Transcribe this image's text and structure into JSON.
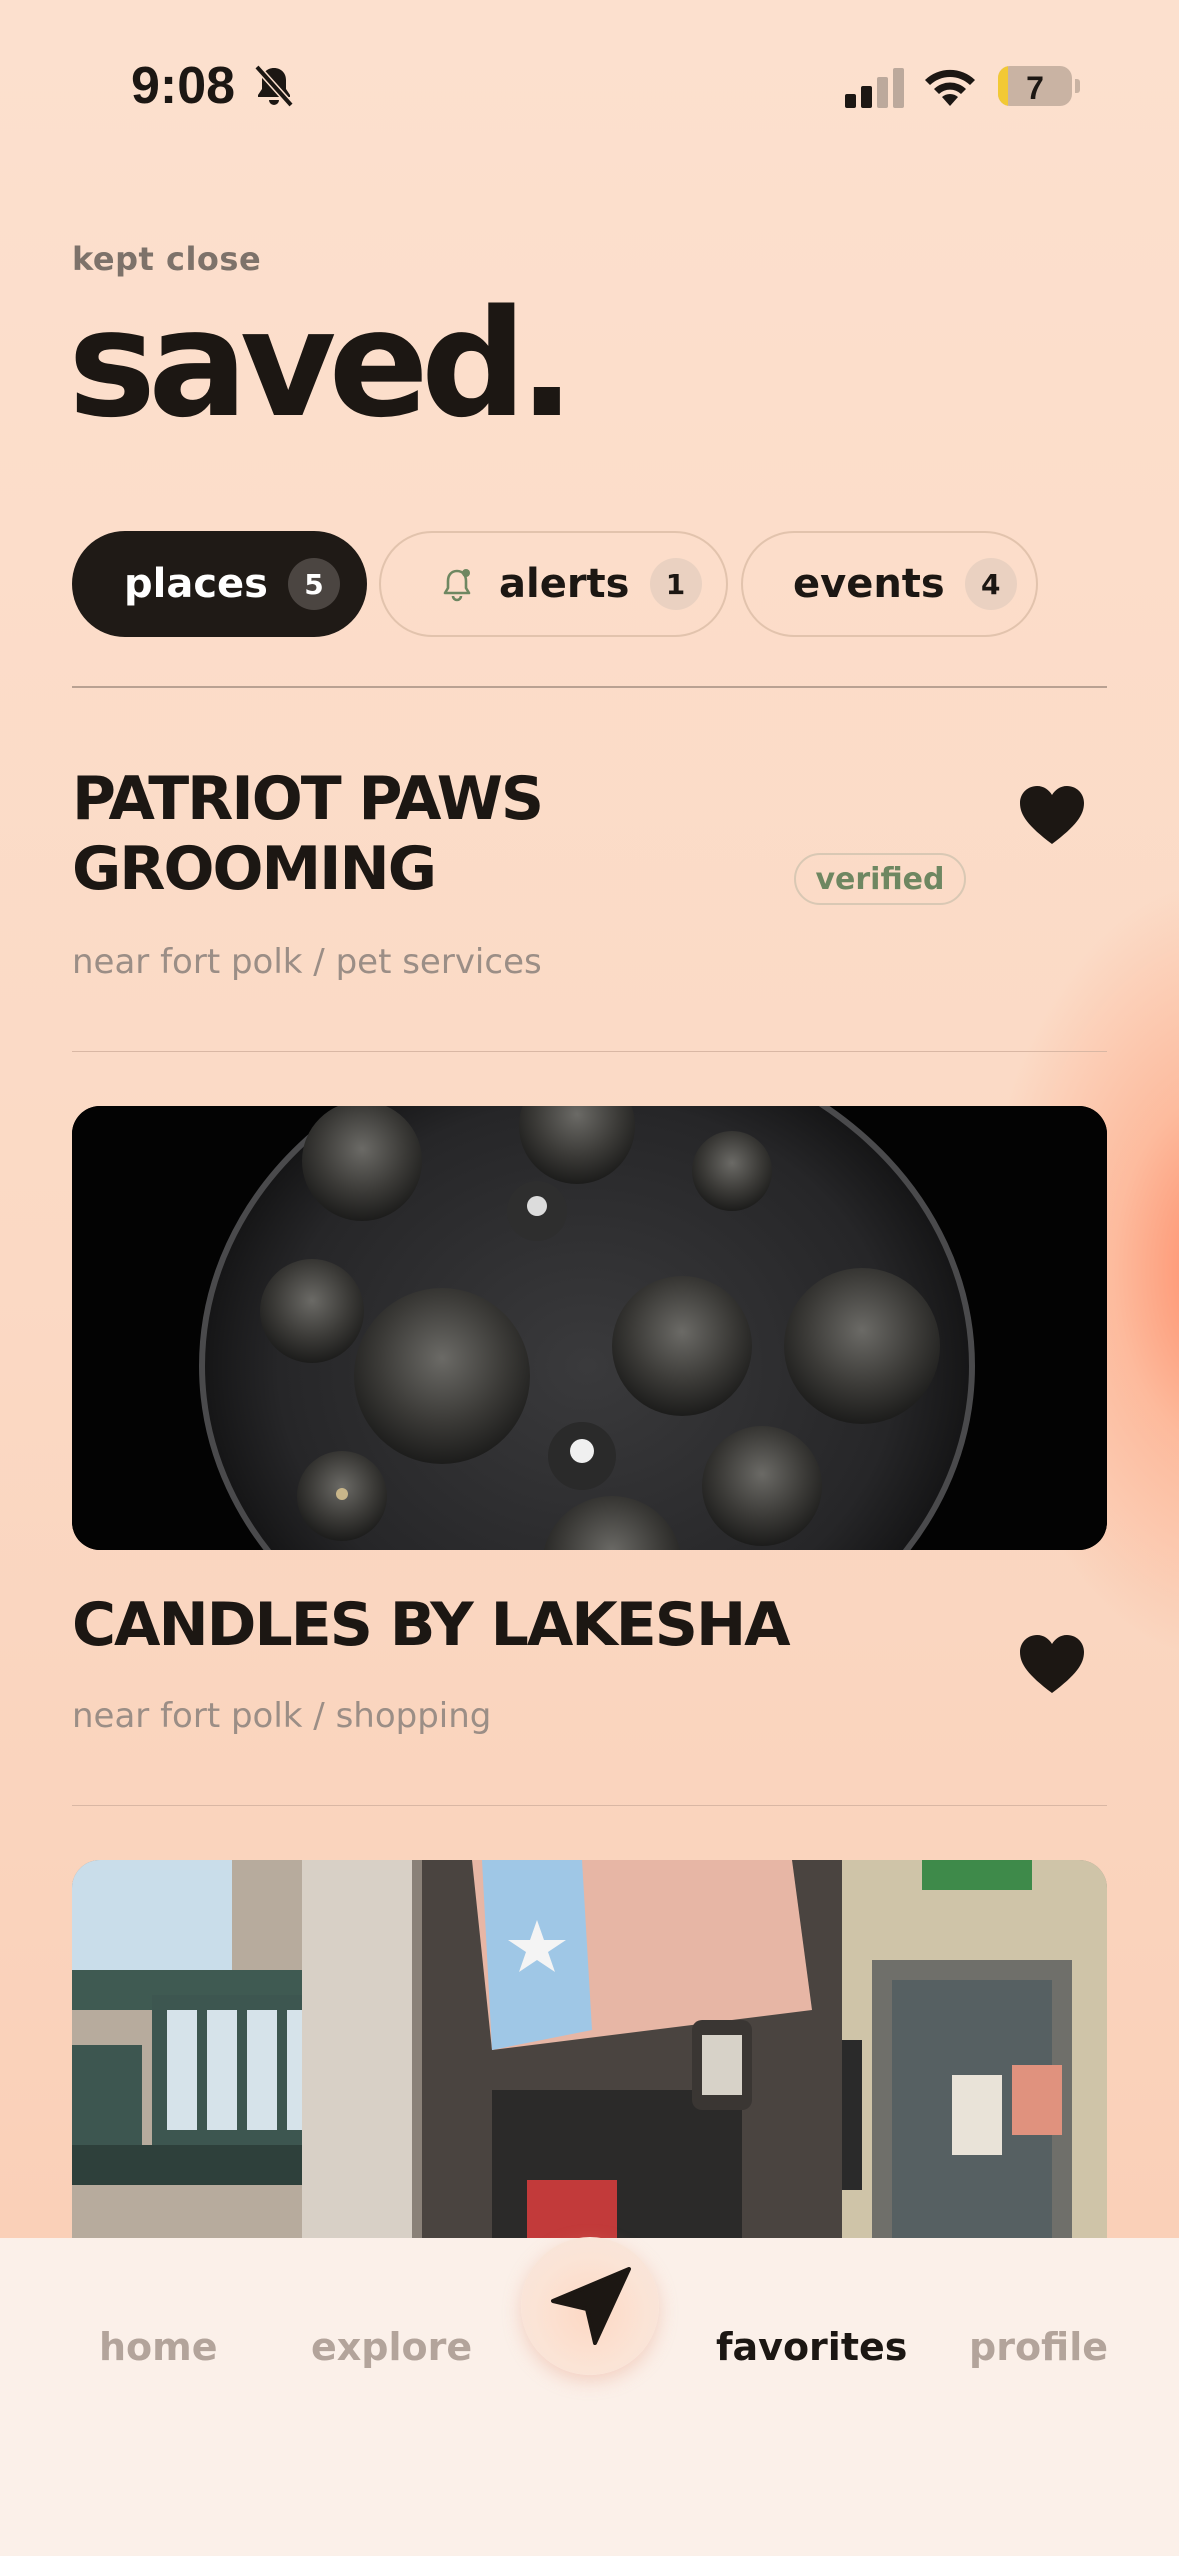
{
  "status_bar": {
    "time": "9:08",
    "battery": "7"
  },
  "header": {
    "eyebrow": "kept close",
    "title": "saved."
  },
  "tabs": [
    {
      "label": "places",
      "count": "5"
    },
    {
      "label": "alerts",
      "count": "1"
    },
    {
      "label": "events",
      "count": "4"
    }
  ],
  "places": [
    {
      "name_line1": "PATRIOT PAWS",
      "name_line2": "GROOMING",
      "meta": "near fort polk / pet services",
      "badge": "verified"
    },
    {
      "name": "CANDLES BY LAKESHA",
      "meta": "near fort polk / shopping"
    }
  ],
  "nav": {
    "home": "home",
    "explore": "explore",
    "favorites": "favorites",
    "profile": "profile"
  },
  "colors": {
    "accent_dark": "#1f1a16",
    "background": "#fbdfcc",
    "verified_green": "#6e8761"
  }
}
